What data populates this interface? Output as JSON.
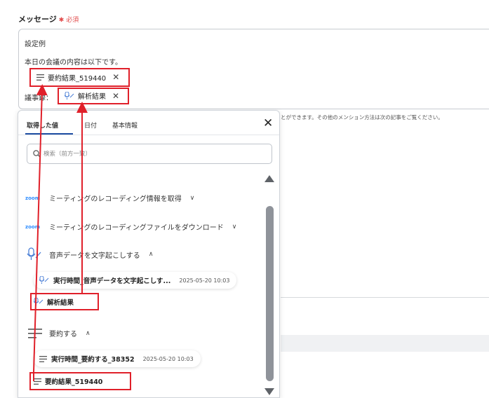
{
  "field": {
    "label": "メッセージ",
    "required": "必須"
  },
  "message": {
    "line1": "設定例",
    "line2": "本日の会議の内容は以下です。",
    "line4_prefix": "議事録：",
    "summary_chip": "要約結果_519440",
    "analysis_chip": "解析結果"
  },
  "helper_text": "とができます。その他のメンション方法は次の記事をご覧ください。",
  "panel": {
    "tabs": [
      "取得した値",
      "日付",
      "基本情報"
    ],
    "search_placeholder": "検索（前方一致）",
    "sections": {
      "zoom1": {
        "logo": "zoom",
        "label": "ミーティングのレコーディング情報を取得",
        "chevron": "∨"
      },
      "zoom2": {
        "logo": "zoom",
        "label": "ミーティングのレコーディングファイルをダウンロード",
        "chevron": "∨"
      },
      "transcribe": {
        "label": "音声データを文字起こしする",
        "chevron": "∧"
      },
      "summarize": {
        "label": "要約する",
        "chevron": "∧"
      }
    },
    "transcribe_run": {
      "name": "実行時間_音声データを文字起こしす...",
      "time": "2025-05-20 10:03"
    },
    "analysis_item": "解析結果",
    "summarize_run": {
      "name": "実行時間_要約する_38352",
      "time": "2025-05-20 10:03"
    },
    "summary_item": "要約結果_519440"
  },
  "colors": {
    "highlight": "#e0202a",
    "tab_accent": "#1f4ea3",
    "zoom_blue": "#2d8cff",
    "required_red": "#e24b4b"
  },
  "icons": [
    "list-icon",
    "mic-icon",
    "close-icon",
    "search-icon",
    "chevron-icon",
    "zoom-logo"
  ]
}
